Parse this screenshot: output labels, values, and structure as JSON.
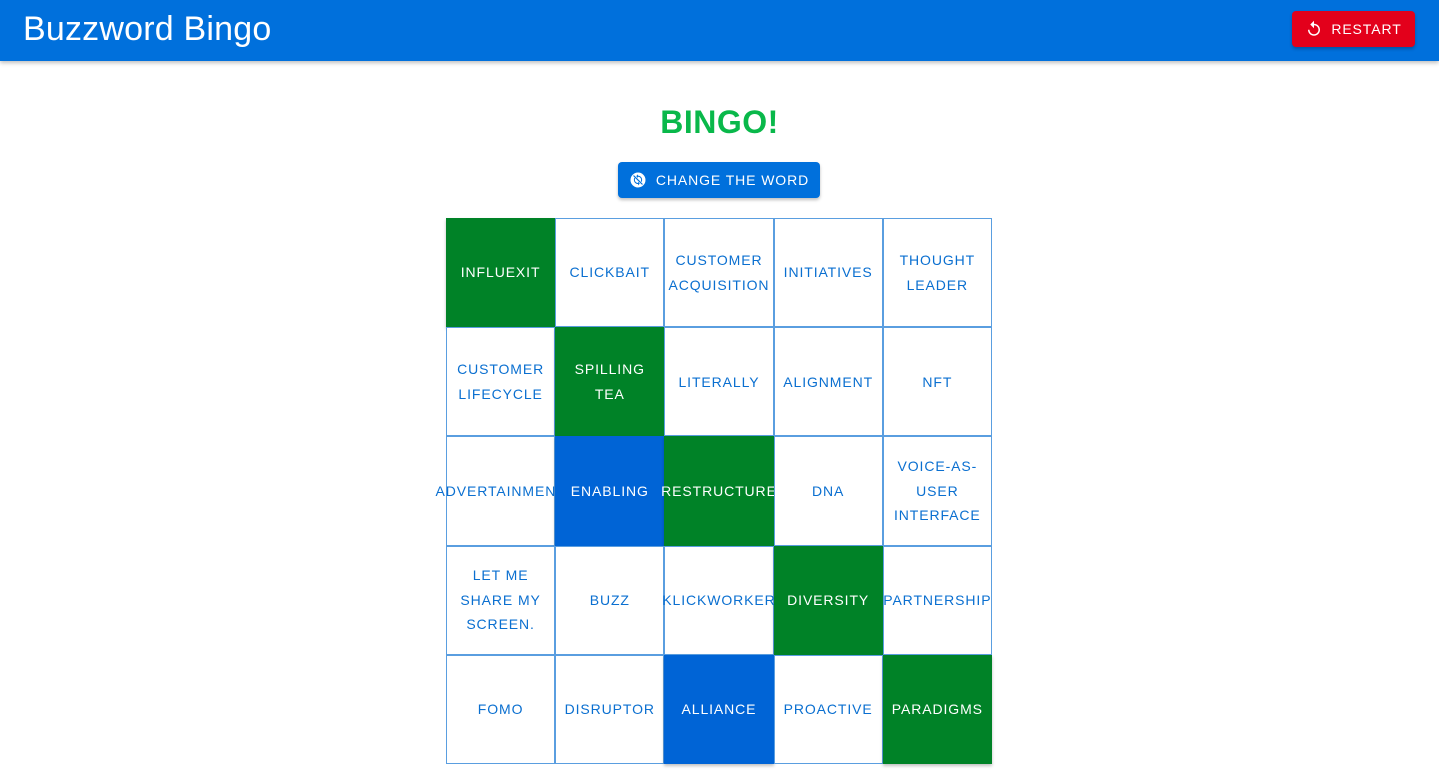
{
  "header": {
    "title": "Buzzword Bingo",
    "restart_label": "Restart",
    "restart_icon": "restart-icon",
    "background_color": "#0070dc",
    "restart_color": "#e3001b"
  },
  "main": {
    "status_text": "BINGO!",
    "status_color": "#09b84a",
    "change_word_label": "Change the word",
    "change_word_icon": "sync-icon"
  },
  "board": {
    "colors": {
      "marked_bingo": "#008227",
      "selected": "#0064d6",
      "unmarked_text": "#0a6fd0"
    },
    "cells": [
      {
        "word": "influexit",
        "state": "bingo"
      },
      {
        "word": "clickbait",
        "state": "none"
      },
      {
        "word": "customer acquisition",
        "state": "none"
      },
      {
        "word": "initiatives",
        "state": "none"
      },
      {
        "word": "thought leader",
        "state": "none"
      },
      {
        "word": "customer lifecycle",
        "state": "none"
      },
      {
        "word": "spilling tea",
        "state": "bingo"
      },
      {
        "word": "literally",
        "state": "none"
      },
      {
        "word": "alignment",
        "state": "none"
      },
      {
        "word": "NFT",
        "state": "none"
      },
      {
        "word": "advertainment",
        "state": "none"
      },
      {
        "word": "enabling",
        "state": "selected"
      },
      {
        "word": "restructure",
        "state": "bingo"
      },
      {
        "word": "DNA",
        "state": "none"
      },
      {
        "word": "voice-as-user interface",
        "state": "none"
      },
      {
        "word": "let me share my screen.",
        "state": "none"
      },
      {
        "word": "buzz",
        "state": "none"
      },
      {
        "word": "klickworker",
        "state": "none"
      },
      {
        "word": "diversity",
        "state": "bingo"
      },
      {
        "word": "partnership",
        "state": "none"
      },
      {
        "word": "FOMO",
        "state": "none"
      },
      {
        "word": "disruptor",
        "state": "none"
      },
      {
        "word": "alliance",
        "state": "selected"
      },
      {
        "word": "proactive",
        "state": "none"
      },
      {
        "word": "paradigms",
        "state": "bingo"
      }
    ]
  }
}
